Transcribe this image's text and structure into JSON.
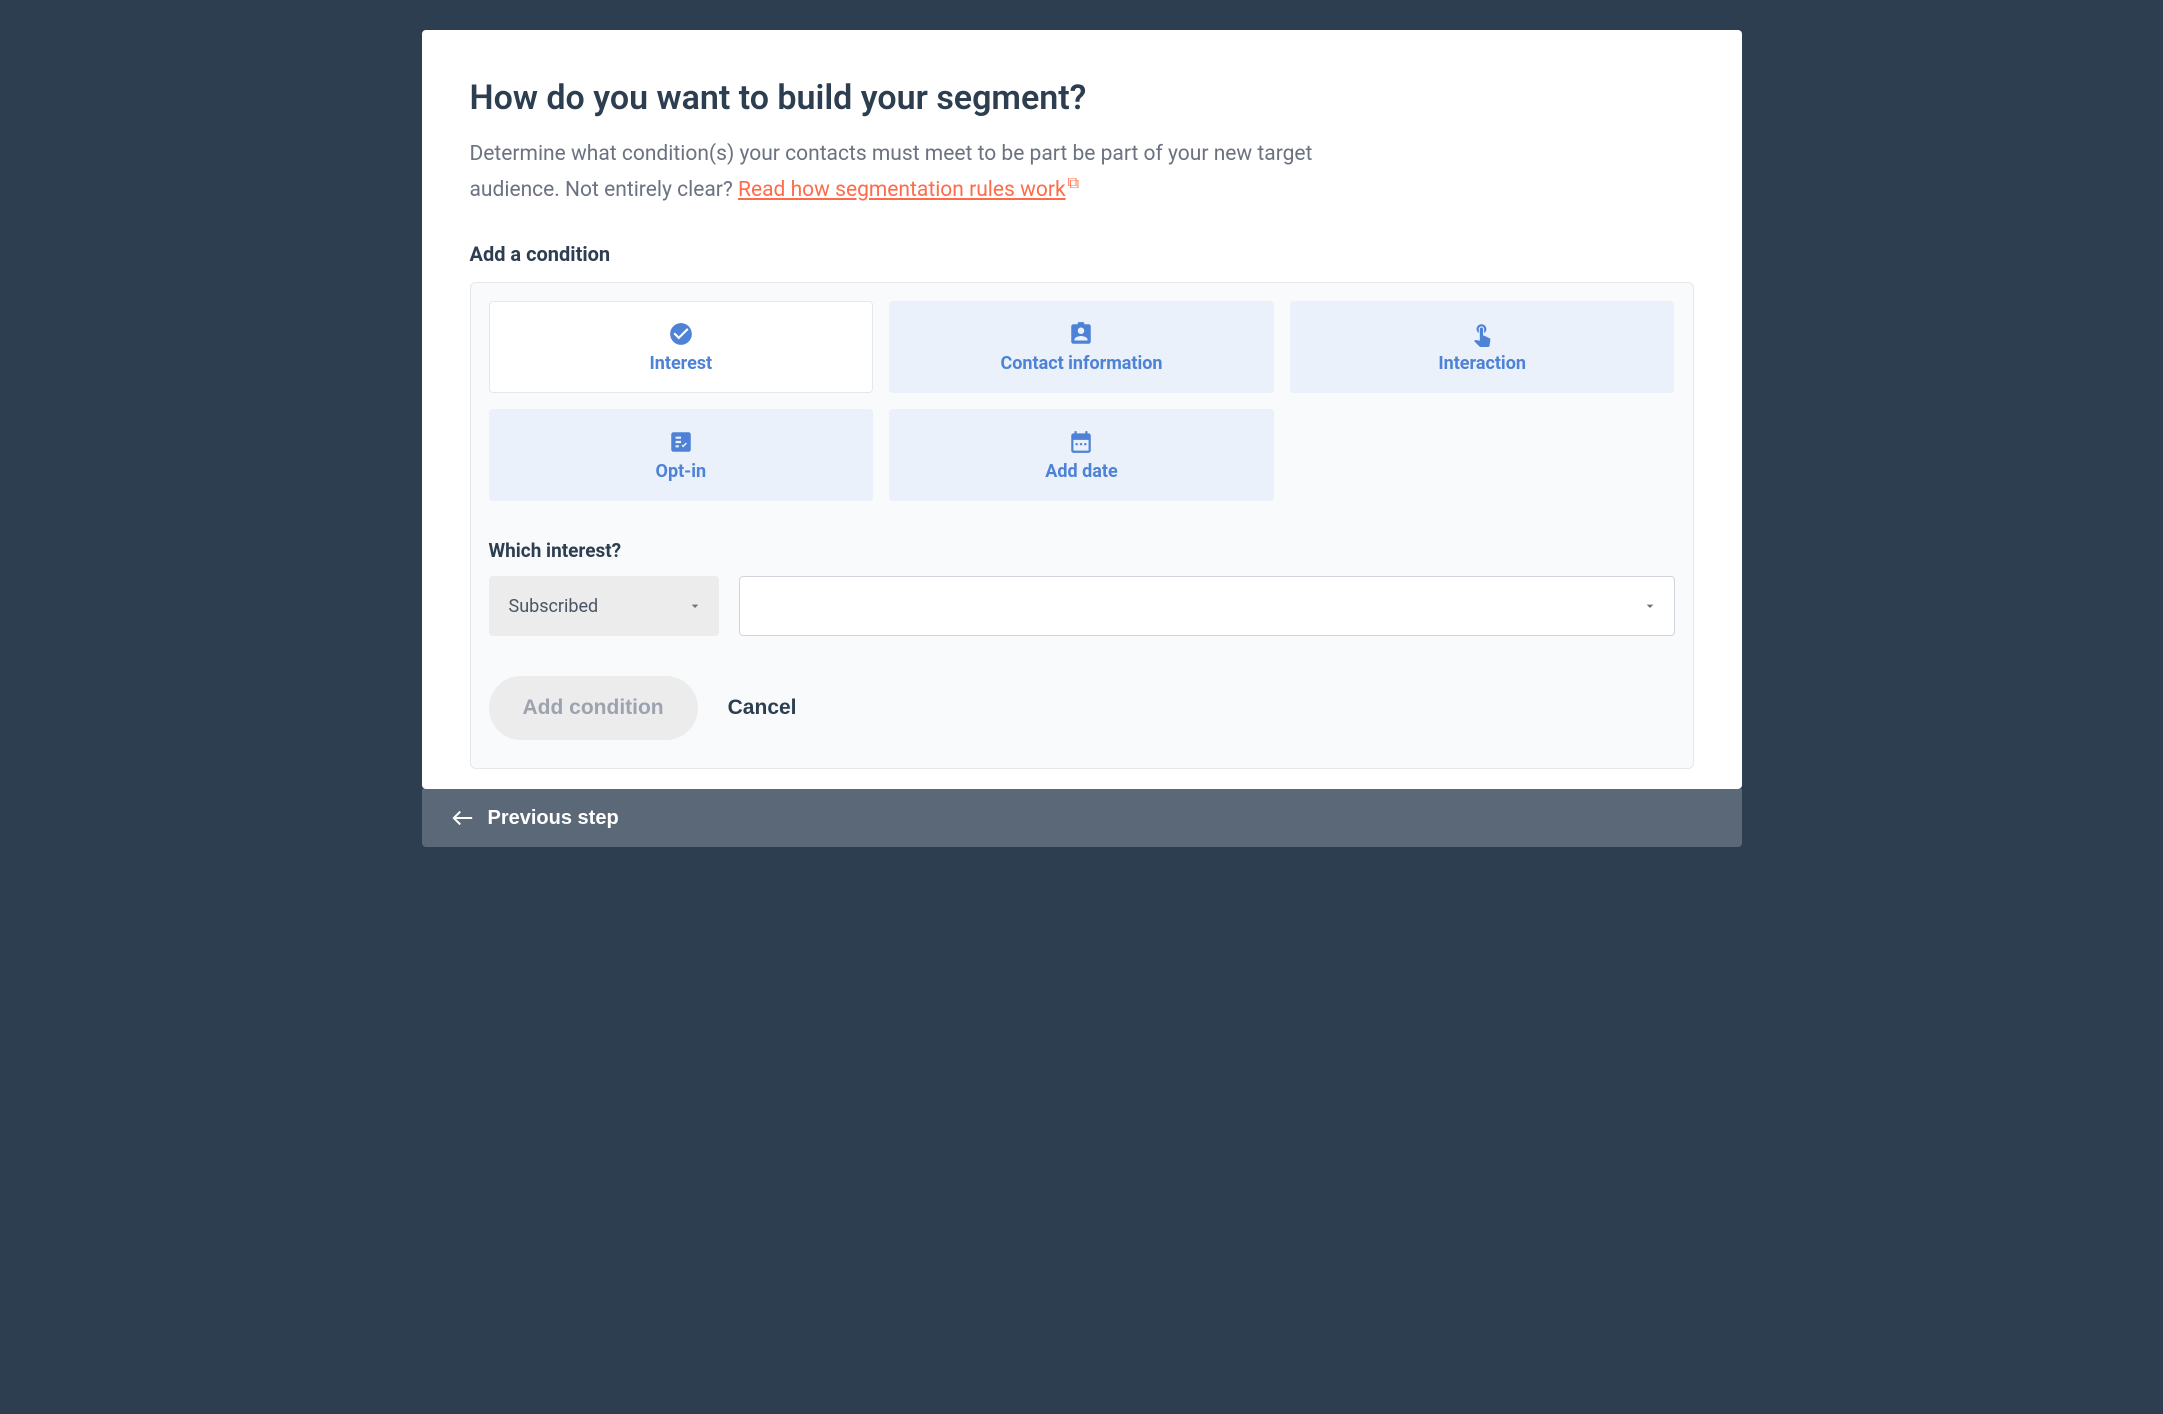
{
  "header": {
    "title": "How do you want to build your segment?",
    "description_prefix": "Determine what condition(s) your contacts must meet to be part be part of your new target audience. Not entirely clear? ",
    "link_text": "Read how segmentation rules work"
  },
  "condition": {
    "heading": "Add a condition",
    "tiles": {
      "interest": "Interest",
      "contact_info": "Contact information",
      "interaction": "Interaction",
      "opt_in": "Opt-in",
      "add_date": "Add date"
    },
    "field_label": "Which interest?",
    "status_select": "Subscribed",
    "add_button": "Add condition",
    "cancel_button": "Cancel"
  },
  "footer": {
    "previous": "Previous step"
  }
}
